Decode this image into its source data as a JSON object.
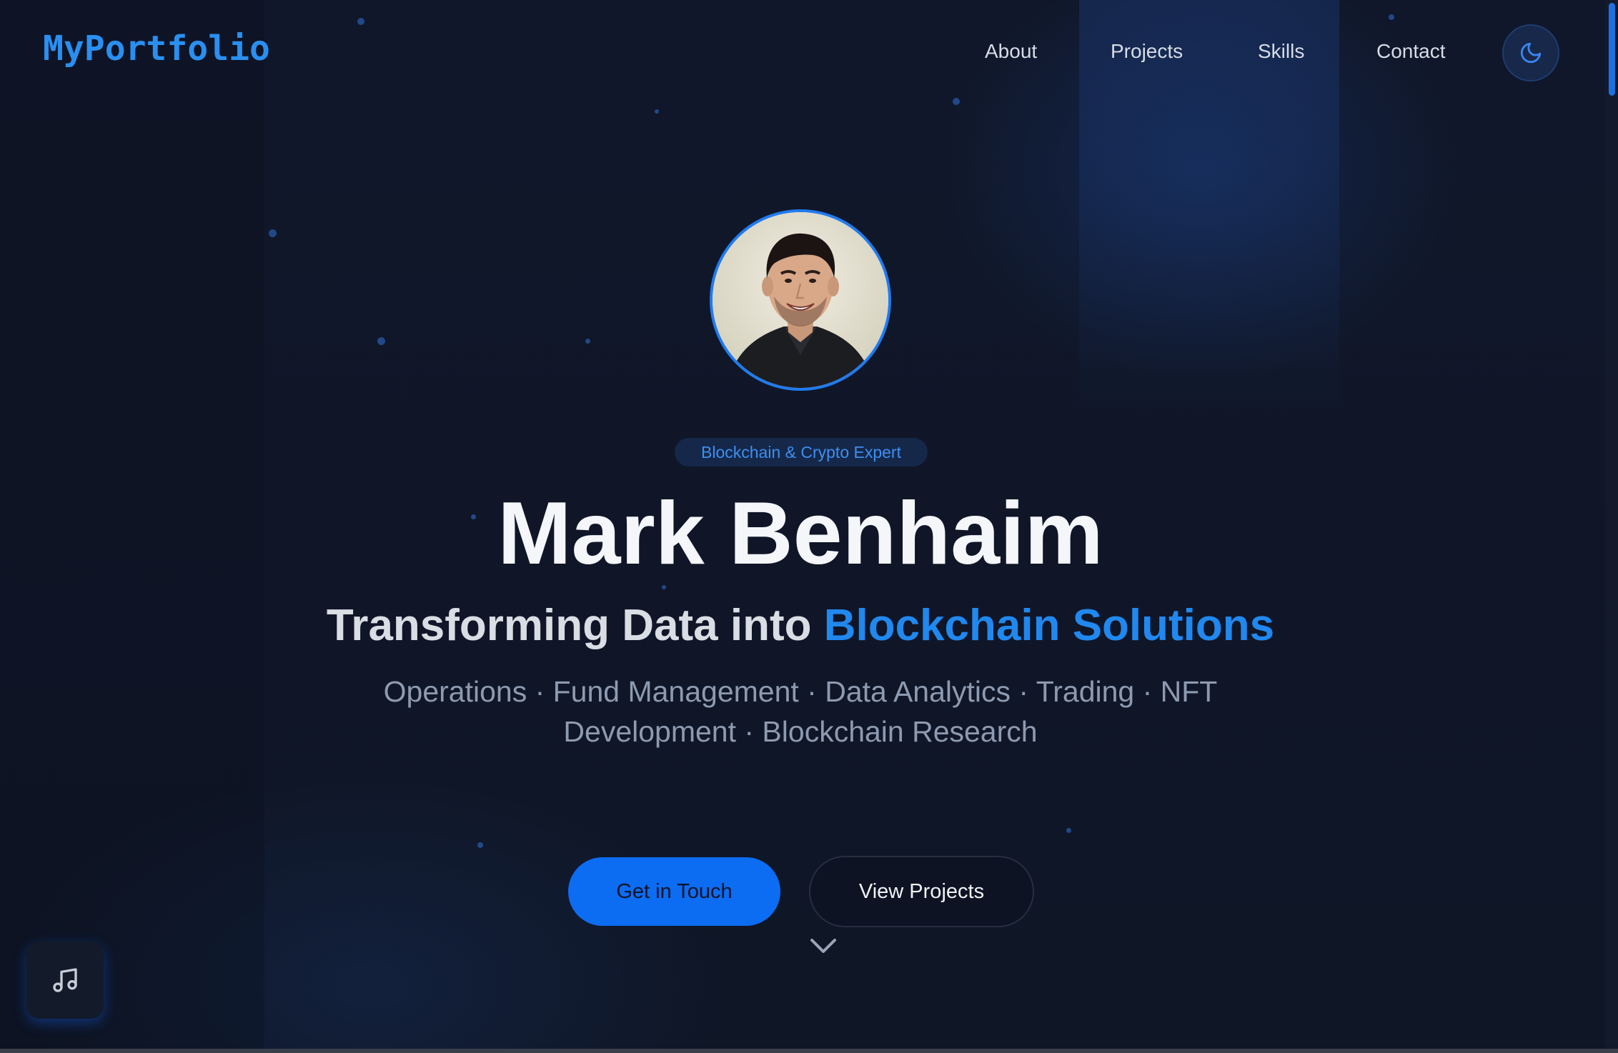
{
  "header": {
    "logo": "MyPortfolio",
    "nav": [
      {
        "label": "About"
      },
      {
        "label": "Projects"
      },
      {
        "label": "Skills"
      },
      {
        "label": "Contact"
      }
    ],
    "theme_toggle_icon": "moon-icon"
  },
  "hero": {
    "avatar_alt": "profile-photo",
    "badge": "Blockchain & Crypto Expert",
    "name": "Mark Benhaim",
    "tagline_prefix": "Transforming Data into ",
    "tagline_highlight": "Blockchain Solutions",
    "roles": "Operations · Fund Management · Data Analytics · Trading · NFT Development · Blockchain Research",
    "primary_button": "Get in Touch",
    "secondary_button": "View Projects",
    "scroll_icon": "chevron-down-icon"
  },
  "music_button_icon": "music-note-icon",
  "colors": {
    "accent": "#1f7bf0",
    "background": "#0f1525",
    "primary_button": "#0c6cf2"
  }
}
